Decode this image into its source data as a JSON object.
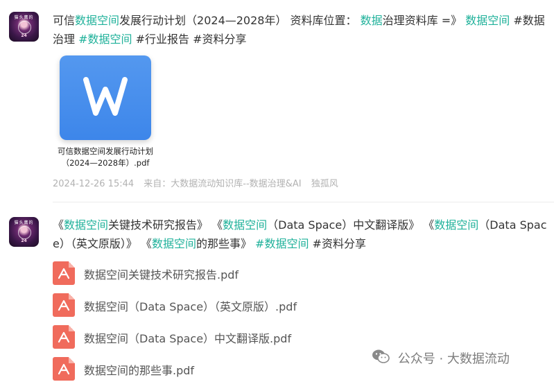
{
  "post1": {
    "avatar_label_top": "猫头鹰的",
    "avatar_label_num": "24",
    "segments": [
      {
        "t": "可信",
        "c": "n"
      },
      {
        "t": "数据空间",
        "c": "kw"
      },
      {
        "t": "发展行动计划（2024—2028年） 资料库位置： ",
        "c": "n"
      },
      {
        "t": "数据",
        "c": "kw"
      },
      {
        "t": "治理资料库 =》 ",
        "c": "n"
      },
      {
        "t": "数据空间",
        "c": "kw"
      },
      {
        "t": " ",
        "c": "n"
      },
      {
        "t": "#数据",
        "c": "n"
      },
      {
        "t": "治理",
        "c": "n"
      },
      {
        "t": "  #数据空间",
        "c": "kw"
      },
      {
        "t": "  #行业报告  #资料分享",
        "c": "n"
      }
    ],
    "file": {
      "icon": "wps-writer-icon",
      "name_line1": "可信数据空间发展行动计划",
      "name_line2": "（2024—2028年）.pdf"
    },
    "meta": {
      "date": "2024-12-26 15:44",
      "source": "来自：大数据流动知识库--数据治理&AI",
      "author": "独孤风"
    }
  },
  "post2": {
    "avatar_label_top": "猫头鹰的",
    "avatar_label_num": "24",
    "segments": [
      {
        "t": "《",
        "c": "n"
      },
      {
        "t": "数据空间",
        "c": "kw"
      },
      {
        "t": "关键技术研究报告》 《",
        "c": "n"
      },
      {
        "t": "数据空间",
        "c": "kw"
      },
      {
        "t": "（Data Space）中文翻译版》 《",
        "c": "n"
      },
      {
        "t": "数据空间",
        "c": "kw"
      },
      {
        "t": "（Data Space）（英文原版）》 《",
        "c": "n"
      },
      {
        "t": "数据空间",
        "c": "kw"
      },
      {
        "t": "的那些事》  ",
        "c": "n"
      },
      {
        "t": "#数据空间",
        "c": "kw"
      },
      {
        "t": "  #资料分享",
        "c": "n"
      }
    ],
    "files": [
      {
        "name": "数据空间关键技术研究报告.pdf"
      },
      {
        "name": "数据空间（Data Space）（英文原版）.pdf"
      },
      {
        "name": "数据空间（Data Space）中文翻译版.pdf"
      },
      {
        "name": "数据空间的那些事.pdf"
      }
    ]
  },
  "watermark": {
    "icon": "wechat-icon",
    "text": "公众号 · 大数据流动"
  },
  "colors": {
    "keyword": "#1fb19a",
    "text": "#333333",
    "meta": "#b2b2b2",
    "pdf": "#f06b5c",
    "wps": "#4a90ea"
  }
}
